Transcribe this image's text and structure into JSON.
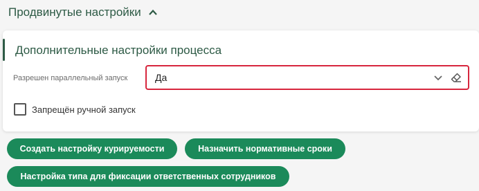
{
  "section": {
    "title": "Продвинутые настройки",
    "chevron_icon": "chevron-up-icon"
  },
  "card": {
    "title": "Дополнительные настройки процесса",
    "parallel_launch": {
      "label": "Разрешен параллельный запуск",
      "value": "Да",
      "icons": [
        "chevron-down-icon",
        "eraser-icon"
      ]
    },
    "manual_launch": {
      "label": "Запрещён ручной запуск",
      "checked": false
    }
  },
  "buttons": {
    "create_curation": "Создать настройку курируемости",
    "assign_deadlines": "Назначить нормативные сроки",
    "responsible_type": "Настройка типа для фиксации ответственных сотрудников"
  },
  "colors": {
    "accent": "#2d5a45",
    "button": "#1b8a5a",
    "highlight_border": "#d7263d"
  }
}
